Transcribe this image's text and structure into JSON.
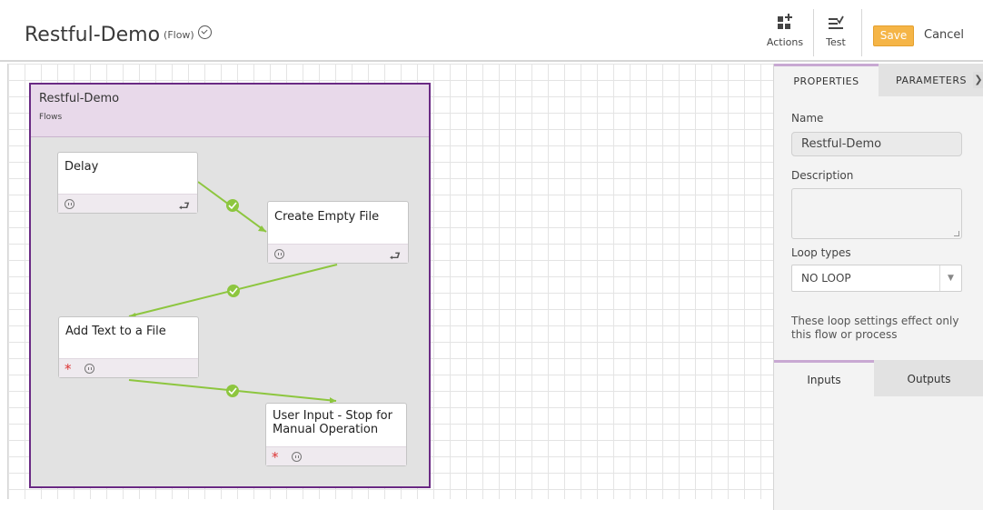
{
  "header": {
    "title": "Restful-Demo",
    "type": "(Flow)",
    "status_icon": "check-circle-icon",
    "actions_label": "Actions",
    "test_label": "Test",
    "save_label": "Save",
    "cancel_label": "Cancel"
  },
  "colors": {
    "flow_border": "#6a2a84",
    "flow_header": "#e8d9ea",
    "link": "#8dc63f",
    "save": "#f5b547",
    "required": "#dd3333"
  },
  "flow": {
    "name": "Restful-Demo",
    "subtitle": "Flows",
    "nodes": [
      {
        "label": "Delay",
        "required": false,
        "loop": true
      },
      {
        "label": "Create Empty File",
        "required": false,
        "loop": true
      },
      {
        "label": "Add Text to a File",
        "required": true,
        "loop": false
      },
      {
        "label": "User Input - Stop for Manual Operation",
        "required": true,
        "loop": false
      }
    ],
    "required_mark": "*"
  },
  "panel": {
    "tabs": [
      "PROPERTIES",
      "PARAMETERS"
    ],
    "name_label": "Name",
    "name_value": "Restful-Demo",
    "description_label": "Description",
    "description_value": "",
    "loop_label": "Loop types",
    "loop_value": "NO LOOP",
    "loop_note": "These loop settings effect only this flow or process",
    "io_tabs": [
      "Inputs",
      "Outputs"
    ]
  }
}
